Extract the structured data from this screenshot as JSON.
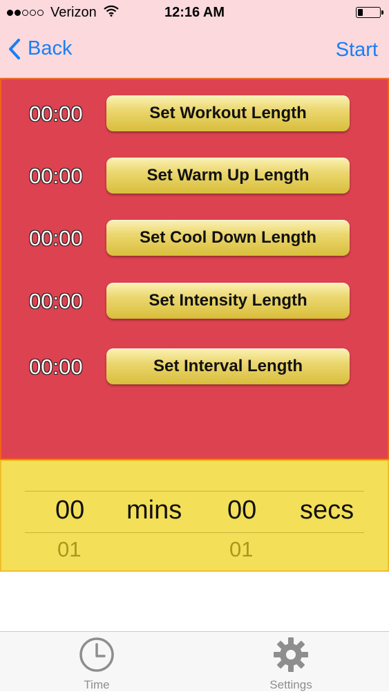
{
  "status_bar": {
    "carrier": "Verizon",
    "time": "12:16 AM",
    "signal_bars_filled": 2,
    "signal_bars_total": 5,
    "battery_level": 0.25
  },
  "nav": {
    "back_label": "Back",
    "start_label": "Start"
  },
  "rows": [
    {
      "value": "00:00",
      "button": "Set Workout Length"
    },
    {
      "value": "00:00",
      "button": "Set Warm Up Length"
    },
    {
      "value": "00:00",
      "button": "Set Cool Down Length"
    },
    {
      "value": "00:00",
      "button": "Set Intensity Length"
    },
    {
      "value": "00:00",
      "button": "Set Interval Length"
    }
  ],
  "picker": {
    "minutes": "00",
    "minutes_unit": "mins",
    "seconds": "00",
    "seconds_unit": "secs",
    "next_minutes": "01",
    "next_seconds": "01"
  },
  "tabs": [
    {
      "label": "Time",
      "icon": "clock-icon"
    },
    {
      "label": "Settings",
      "icon": "gear-icon"
    }
  ],
  "colors": {
    "nav_background": "#fcd9dd",
    "panel_background": "#dd4250",
    "picker_background": "#f4df58",
    "accent_blue": "#1a7ef7",
    "button_gold": "#e3c94f"
  }
}
